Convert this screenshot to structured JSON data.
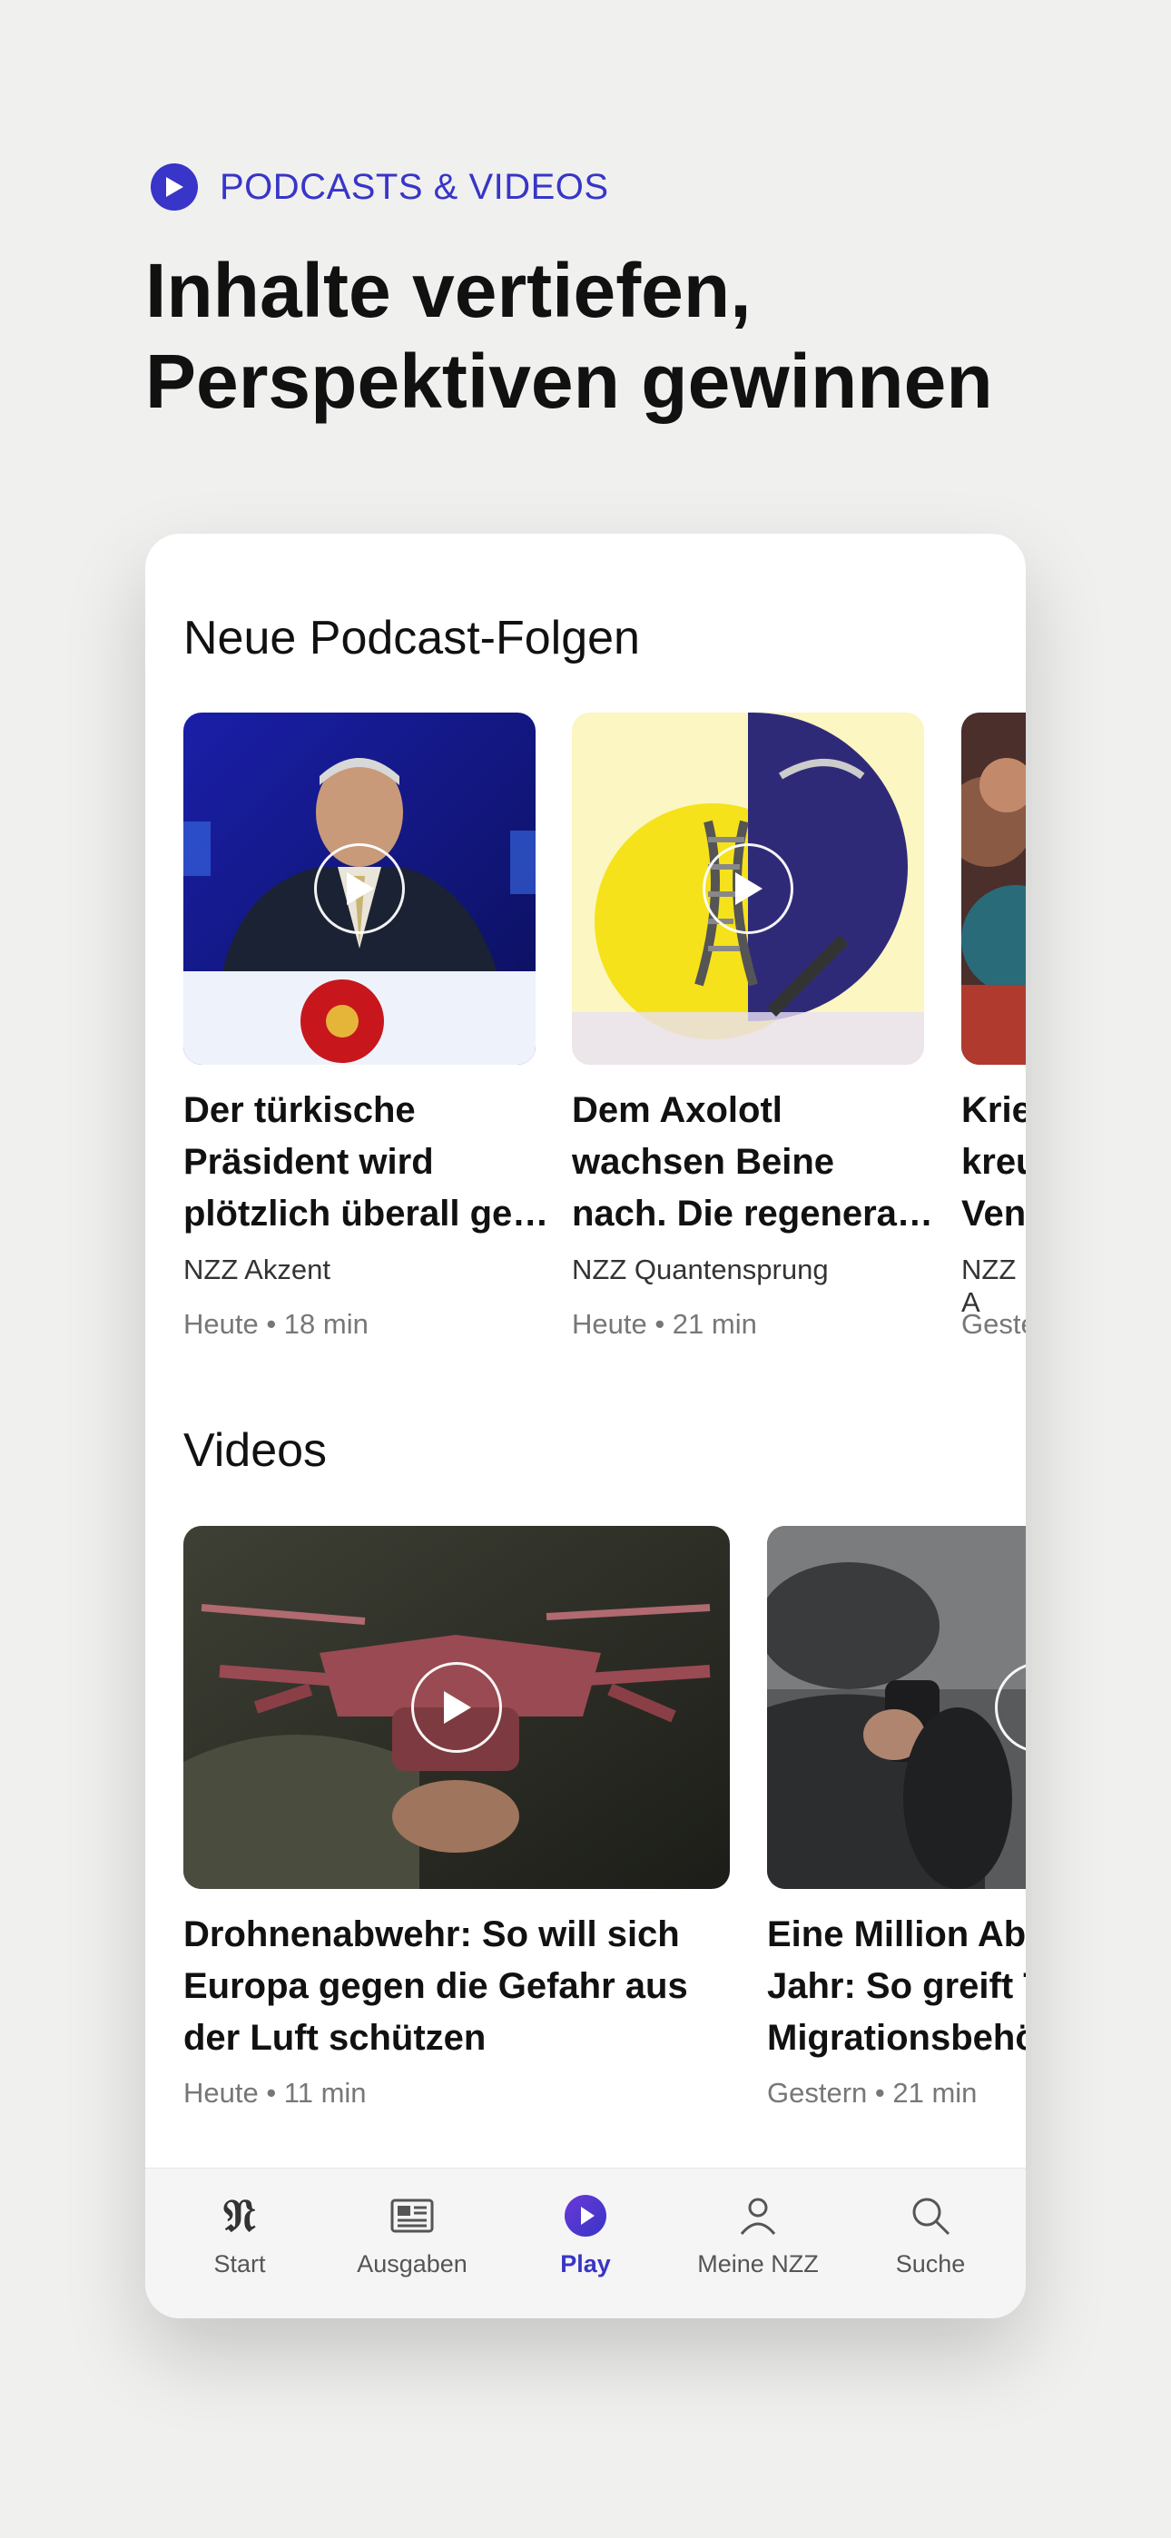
{
  "header": {
    "eyebrow": "PODCASTS & VIDEOS",
    "headline_line1": "Inhalte vertiefen,",
    "headline_line2": "Perspektiven gewinnen"
  },
  "podcasts": {
    "section_title": "Neue Podcast-Folgen",
    "items": [
      {
        "title_lines": [
          "Der türkische",
          "Präsident wird",
          "plötzlich überall ge…"
        ],
        "source": "NZZ Akzent",
        "meta": "Heute • 18 min"
      },
      {
        "title_lines": [
          "Dem Axolotl",
          "wachsen Beine",
          "nach. Die regenera…"
        ],
        "source": "NZZ Quantensprung",
        "meta": "Heute • 21 min"
      },
      {
        "title_lines": [
          "Krie",
          "kreu",
          "Ven"
        ],
        "source": "NZZ A",
        "meta": "Geste"
      }
    ]
  },
  "videos": {
    "section_title": "Videos",
    "items": [
      {
        "title_lines": [
          "Drohnenabwehr: So will sich",
          "Europa gegen die Gefahr aus",
          "der Luft schützen"
        ],
        "meta": "Heute • 11 min"
      },
      {
        "title_lines": [
          "Eine Million Abs",
          "Jahr: So greift T",
          "Migrationsbehö"
        ],
        "meta": "Gestern • 21 min"
      }
    ]
  },
  "tabbar": {
    "tabs": [
      {
        "label": "Start",
        "icon": "nzz-logo-icon"
      },
      {
        "label": "Ausgaben",
        "icon": "newspaper-icon"
      },
      {
        "label": "Play",
        "icon": "play-circle-icon",
        "active": true
      },
      {
        "label": "Meine NZZ",
        "icon": "person-icon"
      },
      {
        "label": "Suche",
        "icon": "search-icon"
      }
    ]
  },
  "colors": {
    "accent": "#3835c8",
    "background": "#f0f0ef",
    "card": "#ffffff"
  }
}
